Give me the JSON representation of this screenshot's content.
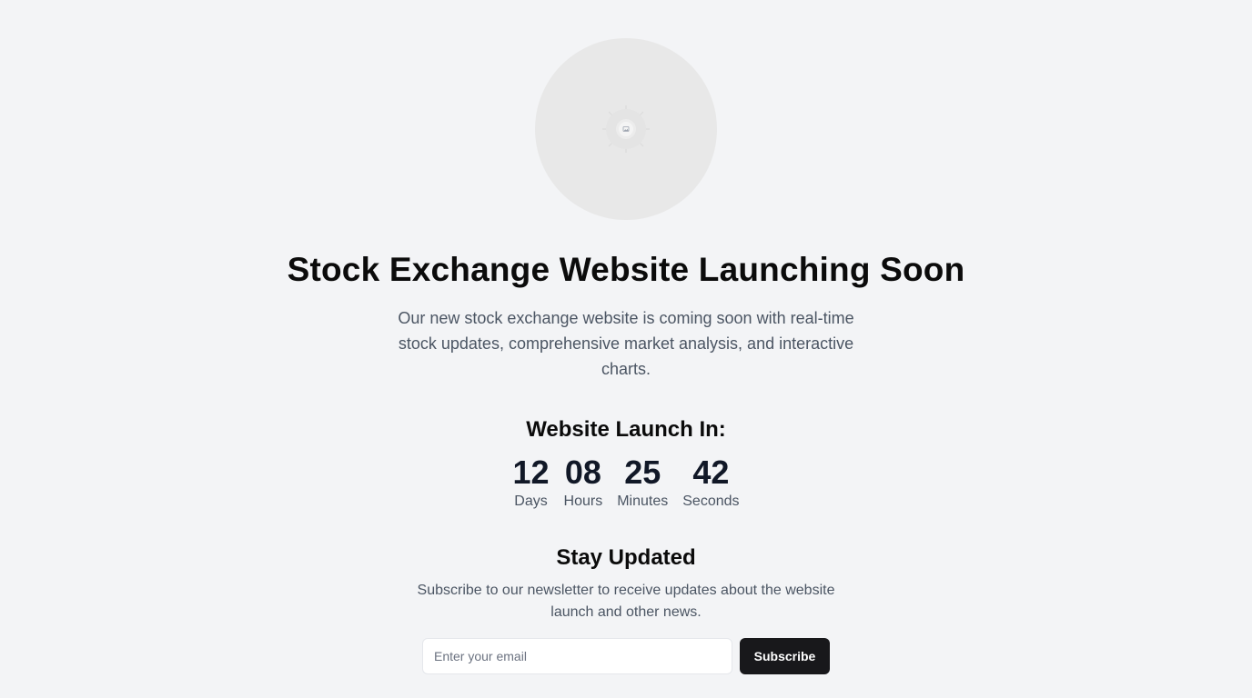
{
  "hero": {
    "image_icon": "image-placeholder-icon"
  },
  "title": "Stock Exchange Website Launching Soon",
  "subtitle": "Our new stock exchange website is coming soon with real-time stock updates, comprehensive market analysis, and interactive charts.",
  "countdown": {
    "heading": "Website Launch In:",
    "units": [
      {
        "value": "12",
        "label": "Days"
      },
      {
        "value": "08",
        "label": "Hours"
      },
      {
        "value": "25",
        "label": "Minutes"
      },
      {
        "value": "42",
        "label": "Seconds"
      }
    ]
  },
  "newsletter": {
    "heading": "Stay Updated",
    "text": "Subscribe to our newsletter to receive updates about the website launch and other news.",
    "email_placeholder": "Enter your email",
    "email_value": "",
    "button_label": "Subscribe"
  },
  "colors": {
    "background": "#f3f4f6",
    "button": "#18181b",
    "text_muted": "#4b5563"
  }
}
